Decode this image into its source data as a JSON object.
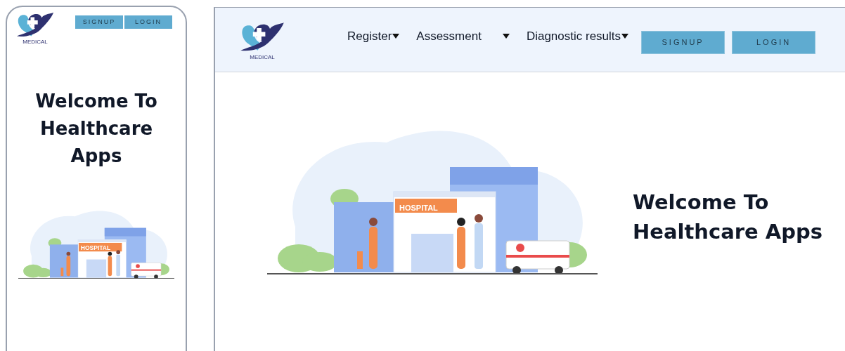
{
  "mobile": {
    "logo": {
      "text": "MEDICAL"
    },
    "buttons": [
      "SIGNUP",
      "LOGIN"
    ],
    "heading": "Welcome To Healthcare Apps",
    "illustration": {
      "sign": "HOSPITAL"
    }
  },
  "desktop": {
    "logo": {
      "text": "MEDICAL"
    },
    "nav": [
      {
        "label": "Register",
        "gap": false
      },
      {
        "label": "Assessment",
        "gap": true
      },
      {
        "label": "Diagnostic results",
        "gap": false
      }
    ],
    "buttons": [
      "SIGNUP",
      "LOGIN"
    ],
    "heading": "Welcome To Healthcare Apps",
    "illustration": {
      "sign": "HOSPITAL"
    }
  }
}
